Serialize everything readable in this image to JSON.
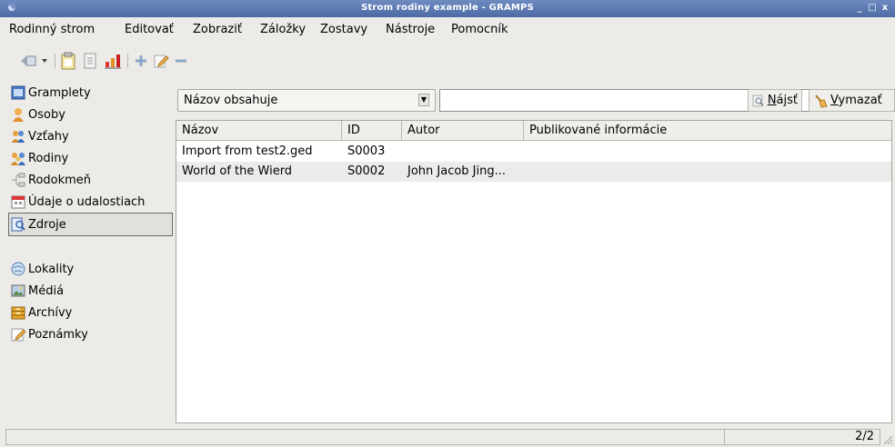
{
  "window": {
    "title": "Strom rodiny example - GRAMPS",
    "controls": [
      "_",
      "□",
      "x"
    ]
  },
  "menu": [
    "Rodinný strom",
    "Editovať",
    "Zobraziť",
    "Záložky",
    "Zostavy",
    "Nástroje",
    "Pomocník"
  ],
  "sidebar": {
    "items": [
      {
        "label": "Gramplety",
        "icon": "gramplets-icon"
      },
      {
        "label": "Osoby",
        "icon": "person-icon"
      },
      {
        "label": "Vzťahy",
        "icon": "relationships-icon"
      },
      {
        "label": "Rodiny",
        "icon": "family-icon"
      },
      {
        "label": "Rodokmeň",
        "icon": "pedigree-icon"
      },
      {
        "label": "Údaje o udalostiach",
        "icon": "events-icon"
      },
      {
        "label": "Zdroje",
        "icon": "sources-icon",
        "active": true
      },
      {
        "label": "Lokality",
        "icon": "places-icon"
      },
      {
        "label": "Médiá",
        "icon": "media-icon"
      },
      {
        "label": "Archívy",
        "icon": "repositories-icon"
      },
      {
        "label": "Poznámky",
        "icon": "notes-icon"
      }
    ]
  },
  "filter": {
    "combo_value": "Názov obsahuje",
    "search_value": "",
    "find_mnemonic": "N",
    "find_rest": "ájsť",
    "clear_mnemonic": "V",
    "clear_rest": "ymazať"
  },
  "table": {
    "columns": [
      "Názov",
      "ID",
      "Autor",
      "Publikované informácie"
    ],
    "rows": [
      [
        "Import from test2.ged",
        "S0003",
        "",
        ""
      ],
      [
        "World of the Wierd",
        "S0002",
        "John Jacob Jing...",
        ""
      ]
    ]
  },
  "status": {
    "message": "",
    "count": "2/2"
  },
  "colors": {
    "titlebar": "#5774b0",
    "accent": "#4e6aa5"
  }
}
